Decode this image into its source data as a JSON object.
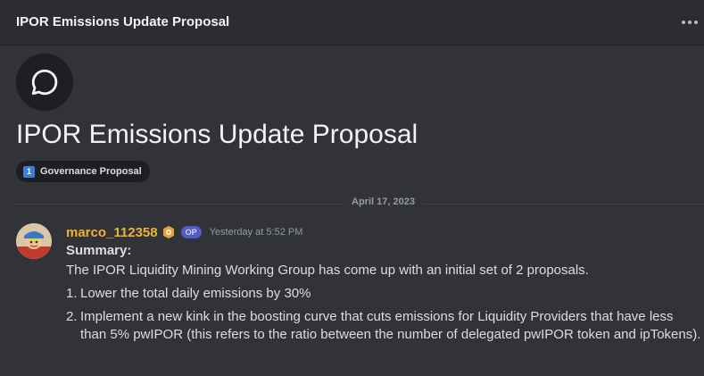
{
  "header": {
    "title": "IPOR Emissions Update Proposal",
    "more_icon": "more-horizontal-icon"
  },
  "thread": {
    "icon": "chat-bubble-icon",
    "title": "IPOR Emissions Update Proposal",
    "tag": {
      "emoji_text": "1",
      "label": "Governance Proposal"
    }
  },
  "divider": {
    "date": "April 17, 2023"
  },
  "message": {
    "username": "marco_112358",
    "username_color": "#f0b232",
    "op_label": "OP",
    "timestamp": "Yesterday at 5:52 PM",
    "summary_heading": "Summary:",
    "intro": "The IPOR Liquidity Mining Working Group has come up with an initial set of 2 proposals.",
    "list": [
      {
        "num": "1.",
        "text": "Lower the total daily emissions by 30%"
      },
      {
        "num": "2.",
        "text": "Implement a new kink in the boosting curve that cuts emissions for Liquidity Providers that have less than 5% pwIPOR (this refers to the ratio between the number of delegated pwIPOR token and ipTokens)."
      }
    ]
  }
}
